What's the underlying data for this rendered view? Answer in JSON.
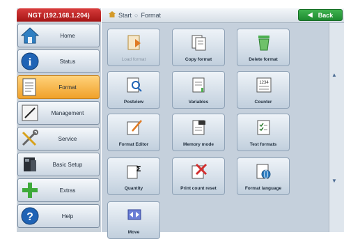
{
  "device": {
    "label": "NGT (192.168.1.204)"
  },
  "breadcrumb": {
    "start": "Start",
    "current": "Format"
  },
  "back_label": "Back",
  "sidebar": {
    "items": [
      {
        "label": "Home",
        "icon": "home-icon"
      },
      {
        "label": "Status",
        "icon": "info-icon"
      },
      {
        "label": "Format",
        "icon": "document-icon",
        "active": true
      },
      {
        "label": "Management",
        "icon": "pen-icon"
      },
      {
        "label": "Service",
        "icon": "tools-icon"
      },
      {
        "label": "Basic Setup",
        "icon": "printer-icon"
      },
      {
        "label": "Extras",
        "icon": "plus-icon"
      },
      {
        "label": "Help",
        "icon": "help-icon"
      }
    ]
  },
  "tiles": [
    {
      "label": "Load format",
      "disabled": true
    },
    {
      "label": "Copy format"
    },
    {
      "label": "Delete format"
    },
    {
      "label": "Postview"
    },
    {
      "label": "Variables"
    },
    {
      "label": "Counter"
    },
    {
      "label": "Format Editor"
    },
    {
      "label": "Memory mode"
    },
    {
      "label": "Test formats"
    },
    {
      "label": "Quantity"
    },
    {
      "label": "Print count reset"
    },
    {
      "label": "Format language"
    },
    {
      "label": "Move"
    }
  ],
  "colors": {
    "accent_active": "#f0a12a",
    "back_green": "#1d8a30",
    "device_red": "#a51414"
  }
}
